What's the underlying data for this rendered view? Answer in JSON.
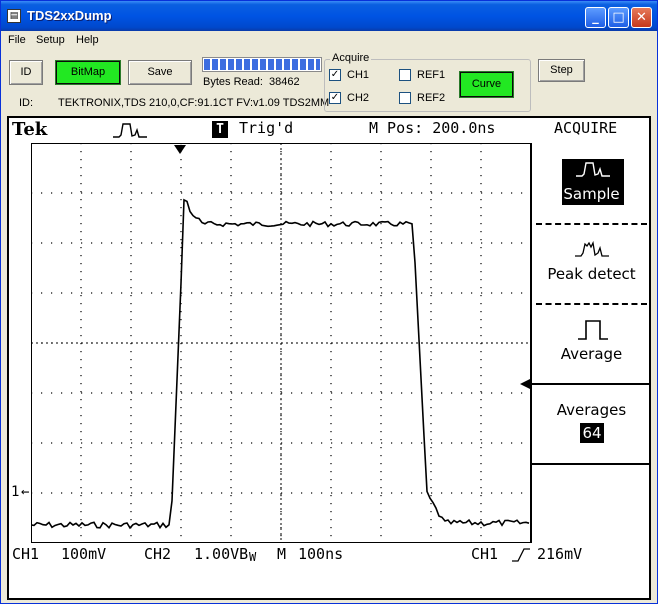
{
  "window": {
    "title": "TDS2xxDump",
    "minimize_icon": "minimize-icon",
    "maximize_icon": "maximize-icon",
    "close_icon": "close-icon"
  },
  "menu": {
    "items": [
      "File",
      "Setup",
      "Help"
    ]
  },
  "toolbar": {
    "id_button": "ID",
    "bitmap_button": "BitMap",
    "save_button": "Save",
    "bytes_read_label": "Bytes Read:",
    "bytes_read_value": "38462",
    "progress_fraction": 1.0,
    "id_label": "ID:",
    "id_value": "TEKTRONIX,TDS 210,0,CF:91.1CT FV:v1.09 TDS2MM",
    "step_button": "Step"
  },
  "acquire_group": {
    "title": "Acquire",
    "ch1": {
      "label": "CH1",
      "checked": true
    },
    "ch2": {
      "label": "CH2",
      "checked": true
    },
    "ref1": {
      "label": "REF1",
      "checked": false
    },
    "ref2": {
      "label": "REF2",
      "checked": false
    },
    "curve_button": "Curve"
  },
  "scope": {
    "brand": "Tek",
    "trig_badge": "T",
    "trig_status": "Trig'd",
    "m_pos": "M Pos: 200.0ns",
    "mode_title": "ACQUIRE",
    "menu": {
      "sample": "Sample",
      "peak_detect": "Peak detect",
      "average": "Average",
      "averages_label": "Averages",
      "averages_value": "64"
    },
    "ch1_marker": "1",
    "bottom": {
      "ch1": "CH1",
      "ch1_scale": "100mV",
      "ch2": "CH2",
      "ch2_scale": "1.00VB",
      "ch2_bw": "W",
      "m_label": "M",
      "m_scale": "100ns",
      "trig_src": "CH1",
      "trig_level": "216mV"
    }
  },
  "colors": {
    "accent_green": "#22e822",
    "title_blue": "#0054e3"
  }
}
